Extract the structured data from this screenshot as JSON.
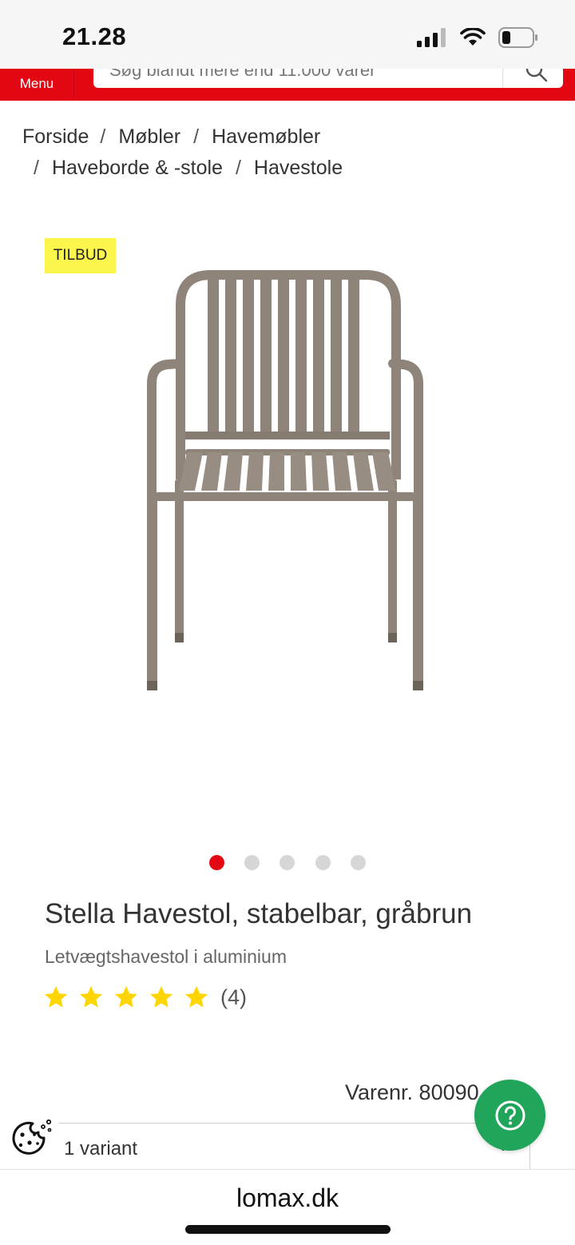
{
  "status_bar": {
    "time": "21.28"
  },
  "header": {
    "menu_label": "Menu",
    "search_placeholder": "Søg blandt mere end 11.000 varer"
  },
  "breadcrumb": {
    "items": [
      {
        "label": "Forside"
      },
      {
        "label": "Møbler"
      },
      {
        "label": "Havemøbler"
      },
      {
        "label": "Haveborde & -stole"
      },
      {
        "label": "Havestole"
      }
    ],
    "separator": "/"
  },
  "product": {
    "badge": "TILBUD",
    "image_icon": "garden-chair",
    "gallery": {
      "count": 5,
      "active_index": 0
    },
    "title": "Stella Havestol, stabelbar, gråbrun",
    "subtitle": "Letvægtshavestol i aluminium",
    "rating": {
      "stars": 5,
      "max": 5,
      "review_count_text": "(4)"
    },
    "item_number_text": "Varenr. 80090",
    "variant_label": "1 variant"
  },
  "browser": {
    "url": "lomax.dk"
  },
  "colors": {
    "brand_red": "#e30613",
    "badge_yellow": "#fbf54c",
    "star_yellow": "#ffd500",
    "help_green": "#21a55b",
    "chair": "#8e8479"
  }
}
